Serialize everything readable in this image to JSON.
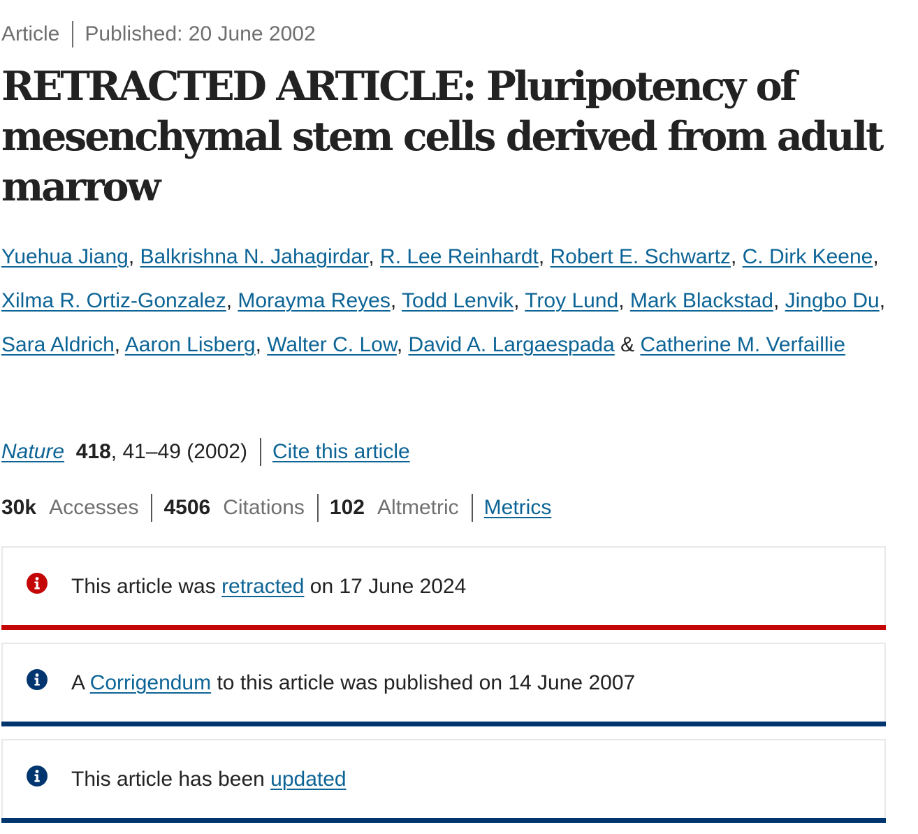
{
  "meta": {
    "type": "Article",
    "published": "Published: 20 June 2002"
  },
  "title": "RETRACTED ARTICLE: Pluripotency of mesenchymal stem cells derived from adult marrow",
  "authors": [
    "Yuehua Jiang",
    "Balkrishna N. Jahagirdar",
    "R. Lee Reinhardt",
    "Robert E. Schwartz",
    "C. Dirk Keene",
    "Xilma R. Ortiz-Gonzalez",
    "Morayma Reyes",
    "Todd Lenvik",
    "Troy Lund",
    "Mark Blackstad",
    "Jingbo Du",
    "Sara Aldrich",
    "Aaron Lisberg",
    "Walter C. Low",
    "David A. Largaespada",
    "Catherine M. Verfaillie"
  ],
  "citation": {
    "journal": "Nature",
    "volume": "418",
    "pages_year": ", 41–49 (2002)",
    "cite_link": "Cite this article"
  },
  "metrics": {
    "accesses_value": "30k",
    "accesses_label": "Accesses",
    "citations_value": "4506",
    "citations_label": "Citations",
    "altmetric_value": "102",
    "altmetric_label": "Altmetric",
    "metrics_link": "Metrics"
  },
  "notices": [
    {
      "before": "This article was ",
      "link": "retracted",
      "after": " on 17 June 2024",
      "color": "#c40606",
      "icon": "info-icon"
    },
    {
      "before": "A ",
      "link": "Corrigendum",
      "after": " to this article was published on 14 June 2007",
      "color": "#01356f",
      "icon": "info-icon"
    },
    {
      "before": "This article has been ",
      "link": "updated",
      "after": "",
      "color": "#01356f",
      "icon": "info-icon"
    }
  ]
}
